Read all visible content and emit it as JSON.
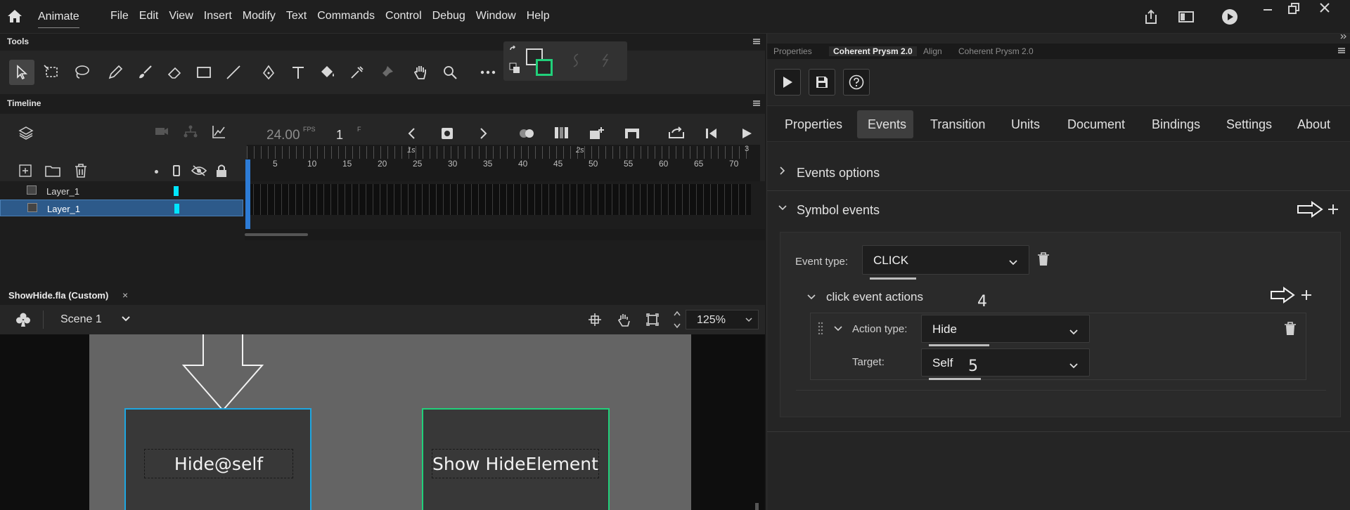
{
  "menubar": {
    "app_name": "Animate",
    "menus": [
      "File",
      "Edit",
      "View",
      "Insert",
      "Modify",
      "Text",
      "Commands",
      "Control",
      "Debug",
      "Window",
      "Help"
    ]
  },
  "tools_panel": {
    "title": "Tools"
  },
  "timeline": {
    "title": "Timeline",
    "fps": "24.00",
    "fps_unit": "FPS",
    "frame": "1",
    "frame_unit": "F",
    "seconds_marks": [
      "1s",
      "2s",
      "3"
    ],
    "frame_numbers": [
      "5",
      "10",
      "15",
      "20",
      "25",
      "30",
      "35",
      "40",
      "45",
      "50",
      "55",
      "60",
      "65",
      "70"
    ],
    "layers": [
      {
        "name": "Layer_1",
        "selected": false
      },
      {
        "name": "Layer_1",
        "selected": true
      }
    ]
  },
  "document": {
    "tab_title": "ShowHide.fla (Custom)",
    "close_glyph": "×",
    "scene": "Scene 1",
    "zoom": "125%"
  },
  "stage": {
    "button_left_label": "Hide@self",
    "button_right_label": "Show HideElement"
  },
  "right_panel": {
    "tabs": [
      "Properties",
      "Coherent Prysm 2.0",
      "Align",
      "Coherent Prysm 2.0"
    ],
    "active_tab": "Coherent Prysm 2.0",
    "nav": [
      "Properties",
      "Events",
      "Transition",
      "Units",
      "Document",
      "Bindings",
      "Settings",
      "About"
    ],
    "active_nav": "Events",
    "events_options_label": "Events options",
    "symbol_events_label": "Symbol events",
    "event_type_label": "Event type:",
    "event_type_value": "CLICK",
    "click_actions_label": "click event actions",
    "annotation_4": "4",
    "action_type_label": "Action type:",
    "action_type_value": "Hide",
    "target_label": "Target:",
    "target_value": "Self",
    "annotation_5": "5"
  },
  "colors": {
    "accent_cyan": "#00e5ff",
    "stage_left_border": "#1ea7e1",
    "stage_right_border": "#21d07a",
    "selected_layer": "#2d5a8a"
  }
}
